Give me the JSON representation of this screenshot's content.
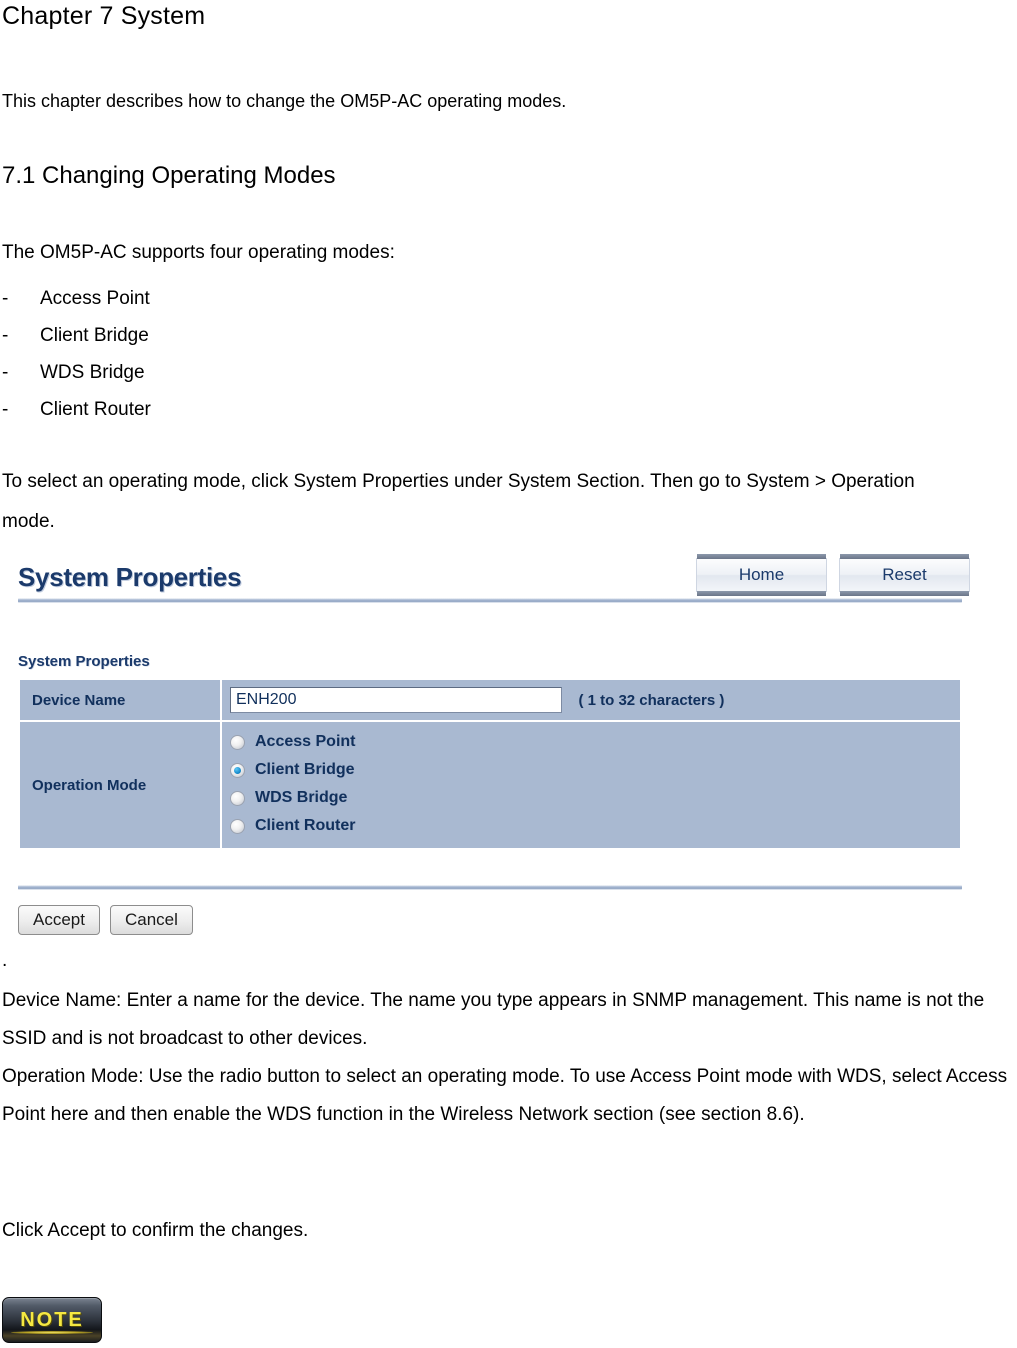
{
  "document": {
    "chapter_title": "Chapter 7 System",
    "intro_paragraph": "This chapter describes how to change the OM5P-AC operating modes.",
    "section_title": "7.1 Changing Operating Modes",
    "modes_intro": "The OM5P-AC supports four operating modes:",
    "modes_list": [
      {
        "bullet": "-",
        "label": "Access Point"
      },
      {
        "bullet": "-",
        "label": "Client Bridge"
      },
      {
        "bullet": "-",
        "label": "WDS Bridge"
      },
      {
        "bullet": "-",
        "label": "Client Router"
      }
    ],
    "select_paragraph": "To select an operating mode, click System Properties under System Section. Then go to System > Operation mode.",
    "dot_line": ".",
    "device_name_block": "Device Name: Enter a name for the device. The name you type appears in SNMP management. This name is not the SSID and is not broadcast to other devices.",
    "operation_mode_block": "Operation Mode: Use the radio button to select an operating mode. To use Access Point mode with WDS, select Access Point here and then enable the WDS function in the Wireless Network section (see section 8.6).",
    "accept_block": "Click Accept to confirm the changes.",
    "note_badge_label": "NOTE"
  },
  "ui_panel": {
    "title": "System Properties",
    "nav_buttons": [
      {
        "label": "Home"
      },
      {
        "label": "Reset"
      }
    ],
    "subtitle": "System Properties",
    "rows": {
      "device_name": {
        "label": "Device Name",
        "value": "ENH200",
        "hint": "( 1 to 32 characters )"
      },
      "operation_mode": {
        "label": "Operation Mode",
        "options": [
          {
            "label": "Access Point",
            "selected": false
          },
          {
            "label": "Client Bridge",
            "selected": true
          },
          {
            "label": "WDS Bridge",
            "selected": false
          },
          {
            "label": "Client Router",
            "selected": false
          }
        ]
      }
    },
    "form_buttons": [
      {
        "label": "Accept"
      },
      {
        "label": "Cancel"
      }
    ]
  },
  "colors": {
    "panel_title": "#1b3a6b",
    "table_row_bg": "#a9b9d1",
    "table_text": "#11305c",
    "divider": "#8ea2c2",
    "radio_selected": "#1a8fd0",
    "note_text": "#f5e842"
  }
}
